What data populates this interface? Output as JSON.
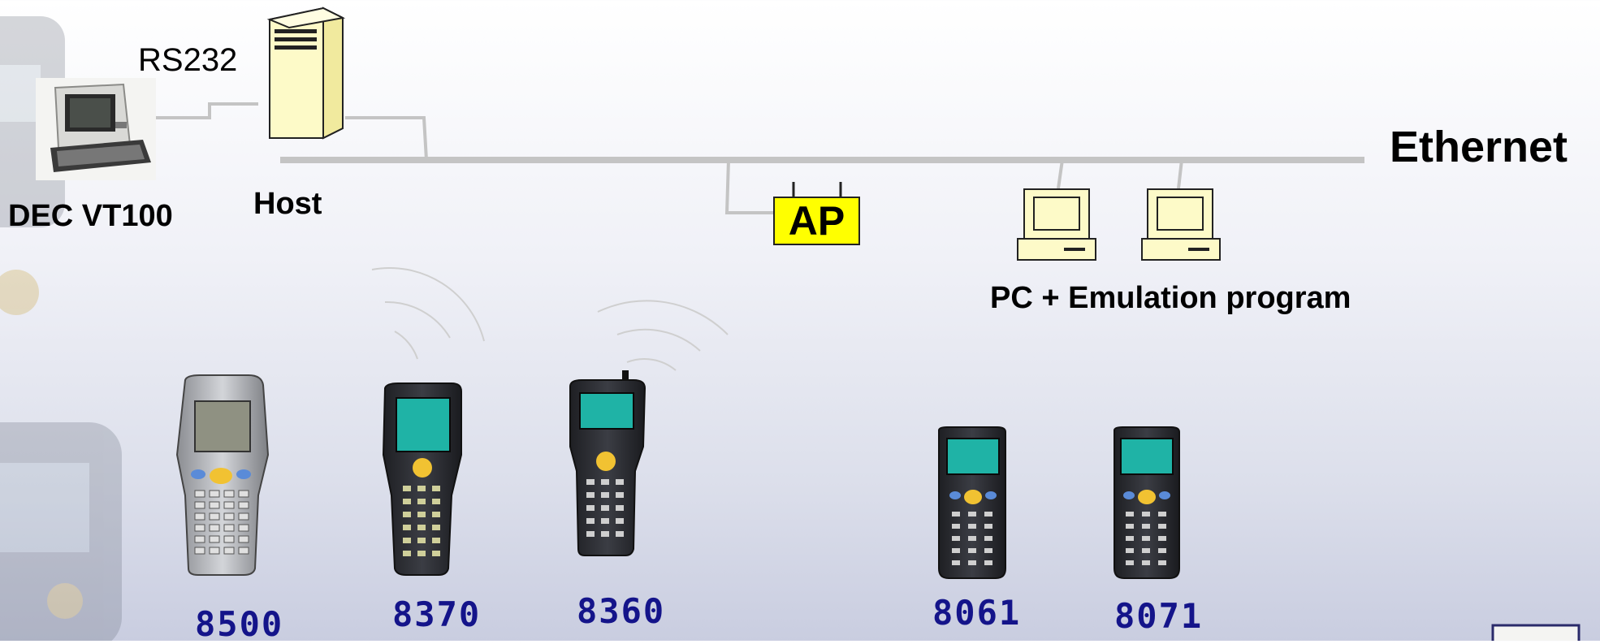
{
  "labels": {
    "rs232": "RS232",
    "terminal": "DEC VT100",
    "host": "Host",
    "network": "Ethernet",
    "ap": "AP",
    "pc_caption": "PC + Emulation program"
  },
  "devices": [
    {
      "model": "8500"
    },
    {
      "model": "8370"
    },
    {
      "model": "8360"
    },
    {
      "model": "8061"
    },
    {
      "model": "8071"
    }
  ],
  "colors": {
    "line": "#c4c4c4",
    "host_fill": "#fdfac8",
    "ap_fill": "#ffff00",
    "pc_fill": "#fdfac8",
    "model_text": "#14148a",
    "lcd": "#1fb3a6"
  }
}
